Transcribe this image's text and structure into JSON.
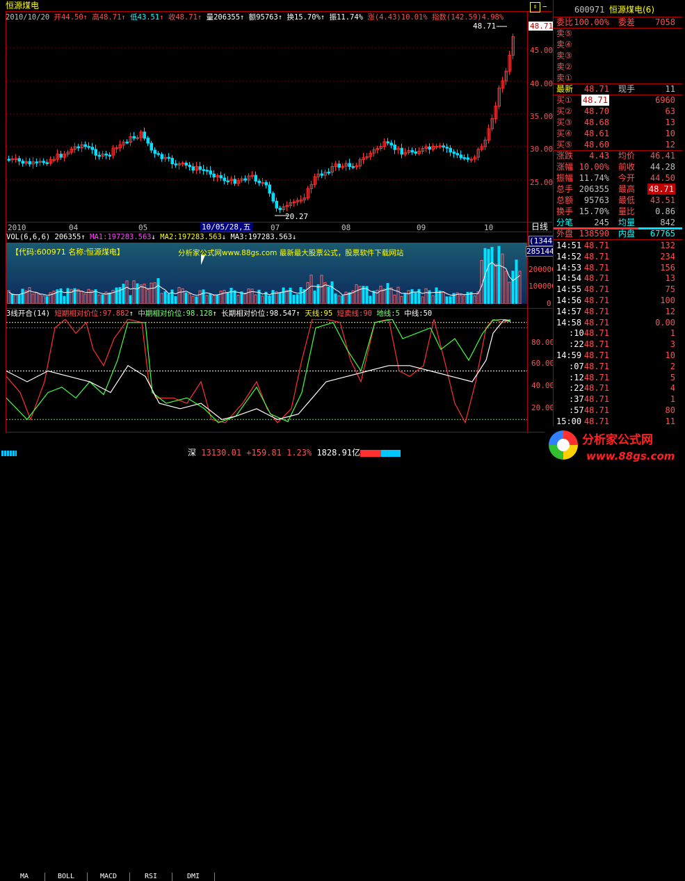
{
  "header": {
    "stock_name": "恒源煤电",
    "date": "2010/10/20",
    "open": "开44.50",
    "high": "高48.71",
    "low": "低43.51",
    "close": "收48.71",
    "volume": "量206355",
    "amount": "额95763",
    "turnover": "换15.70%",
    "amplitude": "振11.74%",
    "change": "涨(4.43)10.01%",
    "index_change": "指数(142.59)4.98%"
  },
  "price_axis": {
    "labels": [
      "45.00",
      "40.00",
      "35.00",
      "30.00",
      "25.00"
    ],
    "high_label": "48.71",
    "low_label": "20.27",
    "current": "48.71"
  },
  "time_axis": {
    "labels": [
      "2010",
      "04",
      "05",
      "07",
      "08",
      "09",
      "10"
    ],
    "cursor": "10/05/28,五",
    "period": "日线"
  },
  "vol_panel": {
    "title": "VOL(6,6,6) 206355",
    "ma1": "MA1:197283.563",
    "ma2": "MA2:197283.563",
    "ma3": "MA3:197283.563",
    "watermark_left": "【代码:600971 名称:恒源煤电】",
    "watermark_center": "分析家公式网www.88gs.com 最新最大股票公式，股票软件下载网站",
    "axis": [
      "200000",
      "100000",
      "0"
    ],
    "box1": "(1344)",
    "box2": "285144"
  },
  "ind_panel": {
    "title": "3线开合(14)",
    "short": "短期相对价位:97.882",
    "mid": "中期相对价位:98.128",
    "long": "长期相对价位:98.547",
    "sky": "天线:95",
    "sell": "短卖线:90",
    "ground": "地线:5",
    "middle": "中线:50",
    "axis": [
      "80.00",
      "60.00",
      "40.00",
      "20.00"
    ]
  },
  "tabs": [
    "MA",
    "BOLL",
    "MACD",
    "RSI",
    "DMI"
  ],
  "status_bar": {
    "market": "深",
    "index": "13130.01",
    "change": "+159.81",
    "pct": "1.23%",
    "amount": "1828.91亿"
  },
  "side": {
    "code": "600971",
    "name": "恒源煤电(6)",
    "ratio_label": "委比",
    "ratio_value": "100.00%",
    "diff_label": "委差",
    "diff_value": "7058",
    "sells": [
      "卖⑤",
      "卖④",
      "卖③",
      "卖②",
      "卖①"
    ],
    "last_label": "最新",
    "last_value": "48.71",
    "hand_label": "现手",
    "hand_value": "11",
    "buys": [
      {
        "label": "买①",
        "price": "48.71",
        "vol": "6960"
      },
      {
        "label": "买②",
        "price": "48.70",
        "vol": "63"
      },
      {
        "label": "买③",
        "price": "48.68",
        "vol": "13"
      },
      {
        "label": "买④",
        "price": "48.61",
        "vol": "10"
      },
      {
        "label": "买⑤",
        "price": "48.60",
        "vol": "12"
      }
    ],
    "stats": [
      {
        "l1": "涨跌",
        "v1": "4.43",
        "l2": "均价",
        "v2": "46.41"
      },
      {
        "l1": "涨幅",
        "v1": "10.00%",
        "l2": "前收",
        "v2": "44.28"
      },
      {
        "l1": "振幅",
        "v1": "11.74%",
        "l2": "今开",
        "v2": "44.50"
      },
      {
        "l1": "总手",
        "v1": "206355",
        "l2": "最高",
        "v2": "48.71"
      },
      {
        "l1": "总额",
        "v1": "95763",
        "l2": "最低",
        "v2": "43.51"
      },
      {
        "l1": "换手",
        "v1": "15.70%",
        "l2": "量比",
        "v2": "0.86"
      },
      {
        "l1": "分笔",
        "v1": "245",
        "l2": "均量",
        "v2": "842"
      },
      {
        "l1": "外盘",
        "v1": "138590",
        "l2": "内盘",
        "v2": "67765"
      }
    ],
    "ticks": [
      {
        "t": "14:51",
        "p": "48.71",
        "v": "132"
      },
      {
        "t": "14:52",
        "p": "48.71",
        "v": "234"
      },
      {
        "t": "14:53",
        "p": "48.71",
        "v": "156"
      },
      {
        "t": "14:54",
        "p": "48.71",
        "v": "13"
      },
      {
        "t": "14:55",
        "p": "48.71",
        "v": "75"
      },
      {
        "t": "14:56",
        "p": "48.71",
        "v": "100"
      },
      {
        "t": "14:57",
        "p": "48.71",
        "v": "12"
      },
      {
        "t": "14:58",
        "p": "48.71",
        "v": "0.00"
      },
      {
        "t": ":10",
        "p": "48.71",
        "v": "1"
      },
      {
        "t": ":22",
        "p": "48.71",
        "v": "3"
      },
      {
        "t": "14:59",
        "p": "48.71",
        "v": "10"
      },
      {
        "t": ":07",
        "p": "48.71",
        "v": "2"
      },
      {
        "t": ":12",
        "p": "48.71",
        "v": "5"
      },
      {
        "t": ":22",
        "p": "48.71",
        "v": "4"
      },
      {
        "t": ":37",
        "p": "48.71",
        "v": "1"
      },
      {
        "t": ":57",
        "p": "48.71",
        "v": "80"
      },
      {
        "t": "15:00",
        "p": "48.71",
        "v": "11"
      }
    ]
  },
  "logo": {
    "text": "分析家公式网",
    "url": "www.88gs.com"
  }
}
